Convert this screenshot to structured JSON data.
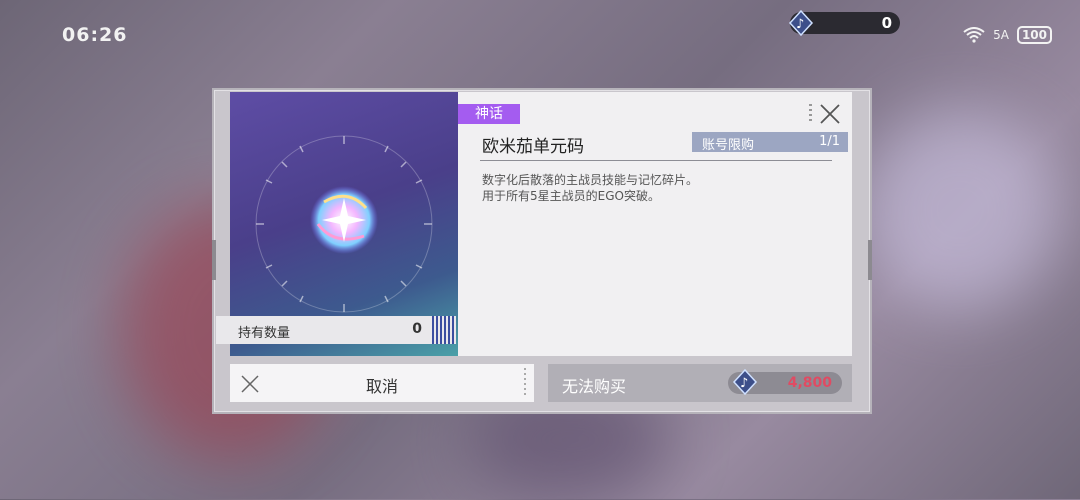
{
  "status_bar": {
    "time": "06:26",
    "signal": "5A",
    "battery": "100"
  },
  "top_currency": {
    "value": "0",
    "icon": "music-note-crystal-icon"
  },
  "dialog": {
    "rarity": "神话",
    "item_name": "欧米茄单元码",
    "limit_label": "账号限购",
    "limit_value": "1/1",
    "description_lines": [
      "数字化后散落的主战员技能与记忆碎片。",
      "用于所有5星主战员的EGO突破。"
    ],
    "hold_label": "持有数量",
    "hold_count": "0",
    "cancel_label": "取消",
    "buy_label": "无法购买",
    "price": "4,800",
    "colors": {
      "rarity": "#a45cf0",
      "price": "#e04b63"
    }
  }
}
